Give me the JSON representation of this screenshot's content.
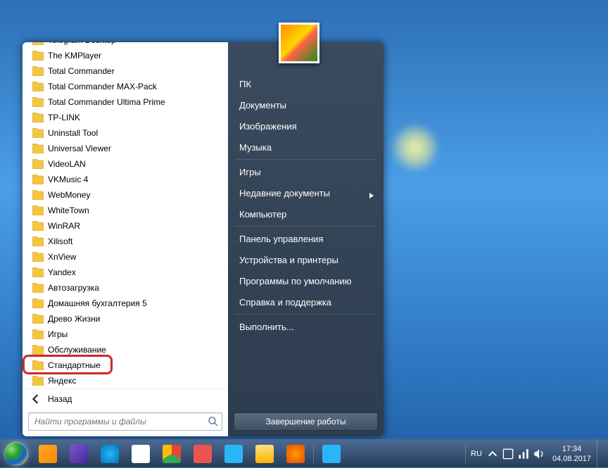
{
  "programs": [
    "Telegram Desktop",
    "The KMPlayer",
    "Total Commander",
    "Total Commander MAX-Pack",
    "Total Commander Ultima Prime",
    "TP-LINK",
    "Uninstall Tool",
    "Universal Viewer",
    "VideoLAN",
    "VKMusic 4",
    "WebMoney",
    "WhiteTown",
    "WinRAR",
    "Xilisoft",
    "XnView",
    "Yandex",
    "Автозагрузка",
    "Домашняя бухгалтерия 5",
    "Древо Жизни",
    "Игры",
    "Обслуживание",
    "Стандартные",
    "Яндекс"
  ],
  "highlighted_index": 21,
  "back_label": "Назад",
  "search_placeholder": "Найти программы и файлы",
  "right_links": {
    "user": "ПК",
    "documents": "Документы",
    "pictures": "Изображения",
    "music": "Музыка",
    "games": "Игры",
    "recent": "Недавние документы",
    "computer": "Компьютер",
    "control_panel": "Панель управления",
    "devices": "Устройства и принтеры",
    "default_programs": "Программы по умолчанию",
    "help": "Справка и поддержка",
    "run": "Выполнить..."
  },
  "shutdown_label": "Завершение работы",
  "taskbar": {
    "icons": [
      {
        "name": "wmp",
        "bg": "linear-gradient(135deg,#ffa726,#fb8c00)"
      },
      {
        "name": "player-purple",
        "bg": "linear-gradient(135deg,#7e57c2,#4527a0)"
      },
      {
        "name": "ie",
        "bg": "radial-gradient(circle,#29b6f6,#0277bd)"
      },
      {
        "name": "yandex",
        "bg": "#fff"
      },
      {
        "name": "chrome",
        "bg": "conic-gradient(#ea4335 0 120deg,#34a853 120deg 240deg,#fbbc05 240deg 360deg)"
      },
      {
        "name": "vivaldi",
        "bg": "#ef5350"
      },
      {
        "name": "maxthon",
        "bg": "#29b6f6"
      },
      {
        "name": "explorer",
        "bg": "linear-gradient(#ffe082,#ffb300)"
      },
      {
        "name": "firefox",
        "bg": "radial-gradient(circle,#ff9800,#e65100)"
      },
      {
        "name": "telegram",
        "bg": "#29b6f6"
      }
    ]
  },
  "tray": {
    "lang": "RU",
    "time": "17:34",
    "date": "04.08.2017"
  }
}
